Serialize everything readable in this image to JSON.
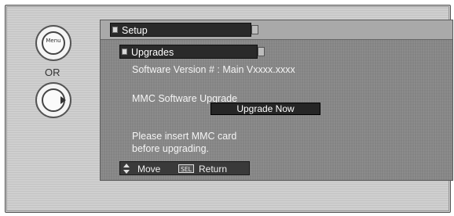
{
  "remote": {
    "menu_key_label": "Menu",
    "or_label": "OR"
  },
  "osd": {
    "setup_title": "Setup",
    "upgrades_title": "Upgrades",
    "software_version": "Software Version #  :  Main Vxxxx.xxxx",
    "mmc_label": "MMC Software Upgrade",
    "upgrade_button": "Upgrade Now",
    "message_line1": "Please insert MMC card",
    "message_line2": "before upgrading."
  },
  "footer": {
    "move_label": "Move",
    "sel_key": "SEL",
    "return_label": "Return"
  },
  "icons": {
    "move": "up-down-arrows-icon",
    "right": "right-arrow-icon",
    "sel": "sel-key-icon"
  }
}
